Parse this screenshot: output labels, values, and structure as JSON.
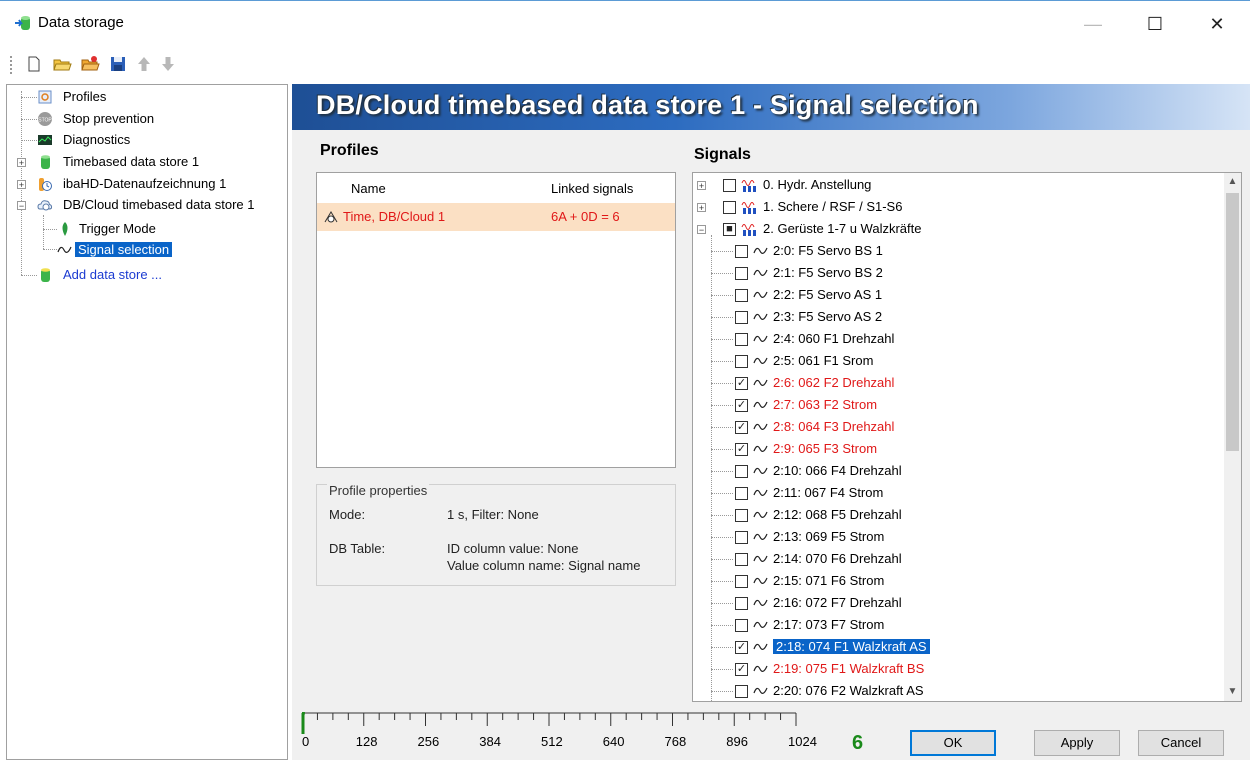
{
  "window": {
    "title": "Data storage",
    "minimize_glyph": "—",
    "maximize_glyph": "☐",
    "close_glyph": "✕"
  },
  "toolbar": {
    "icons": [
      "new-icon",
      "open-icon",
      "open-folder-icon",
      "save-icon",
      "move-up-icon",
      "move-down-icon"
    ]
  },
  "tree": {
    "items": [
      {
        "label": "Profiles",
        "icon": "profiles-icon"
      },
      {
        "label": "Stop prevention",
        "icon": "stop-icon"
      },
      {
        "label": "Diagnostics",
        "icon": "diagnostics-icon"
      },
      {
        "label": "Timebased data store 1",
        "icon": "datastore-icon"
      },
      {
        "label": "ibaHD-Datenaufzeichnung 1",
        "icon": "hd-store-icon"
      },
      {
        "label": "DB/Cloud timebased data store 1",
        "icon": "cloud-store-icon"
      },
      {
        "label": "Trigger Mode",
        "icon": "trigger-icon"
      },
      {
        "label": "Signal selection",
        "icon": "signal-icon",
        "selected": true
      },
      {
        "label": "Add data store ...",
        "icon": "add-store-icon"
      }
    ]
  },
  "banner": {
    "title": "DB/Cloud timebased data store 1 - Signal selection"
  },
  "profiles": {
    "header": "Profiles",
    "col_name": "Name",
    "col_linked": "Linked signals",
    "row": {
      "name": "Time, DB/Cloud 1",
      "linked": "6A + 0D = 6"
    }
  },
  "profile_properties": {
    "legend": "Profile properties",
    "mode_label": "Mode:",
    "mode_value": "1 s, Filter: None",
    "table_label": "DB Table:",
    "table_value_1": "ID column value: None",
    "table_value_2": "Value column name: Signal name"
  },
  "signals": {
    "header": "Signals",
    "groups": [
      {
        "label": "0. Hydr. Anstellung",
        "expanded": false
      },
      {
        "label": "1. Schere / RSF / S1-S6",
        "expanded": false
      },
      {
        "label": "2. Gerüste 1-7  u  Walzkräfte",
        "expanded": true
      }
    ],
    "items": [
      {
        "label": "2:0: F5 Servo BS 1",
        "checked": false
      },
      {
        "label": "2:1: F5 Servo BS 2",
        "checked": false
      },
      {
        "label": "2:2: F5 Servo  AS 1",
        "checked": false
      },
      {
        "label": "2:3: F5 Servo AS 2",
        "checked": false
      },
      {
        "label": "2:4: 060 F1 Drehzahl",
        "checked": false
      },
      {
        "label": "2:5: 061 F1 Srom",
        "checked": false
      },
      {
        "label": "2:6: 062 F2 Drehzahl",
        "checked": true
      },
      {
        "label": "2:7: 063 F2 Strom",
        "checked": true
      },
      {
        "label": "2:8: 064 F3 Drehzahl",
        "checked": true
      },
      {
        "label": "2:9: 065 F3 Strom",
        "checked": true
      },
      {
        "label": "2:10: 066 F4 Drehzahl",
        "checked": false
      },
      {
        "label": "2:11: 067 F4 Strom",
        "checked": false
      },
      {
        "label": "2:12: 068 F5 Drehzahl",
        "checked": false
      },
      {
        "label": "2:13: 069 F5 Strom",
        "checked": false
      },
      {
        "label": "2:14: 070 F6 Drehzahl",
        "checked": false
      },
      {
        "label": "2:15: 071 F6 Strom",
        "checked": false
      },
      {
        "label": "2:16: 072 F7 Drehzahl",
        "checked": false
      },
      {
        "label": "2:17: 073 F7 Strom",
        "checked": false
      },
      {
        "label": "2:18: 074 F1 Walzkraft AS",
        "checked": true,
        "selected": true
      },
      {
        "label": "2:19: 075 F1 Walzkraft BS",
        "checked": true
      },
      {
        "label": "2:20: 076 F2 Walzkraft AS",
        "checked": false
      }
    ]
  },
  "ruler": {
    "labels": [
      "0",
      "128",
      "256",
      "384",
      "512",
      "640",
      "768",
      "896",
      "1024"
    ],
    "max": 1024,
    "value": 6
  },
  "count": "6",
  "buttons": {
    "ok": "OK",
    "apply": "Apply",
    "cancel": "Cancel"
  },
  "colors": {
    "accent": "#0a64c8",
    "checked_red": "#e01818",
    "count_green": "#1a8a1a",
    "profile_row": "#fbe0c4"
  }
}
